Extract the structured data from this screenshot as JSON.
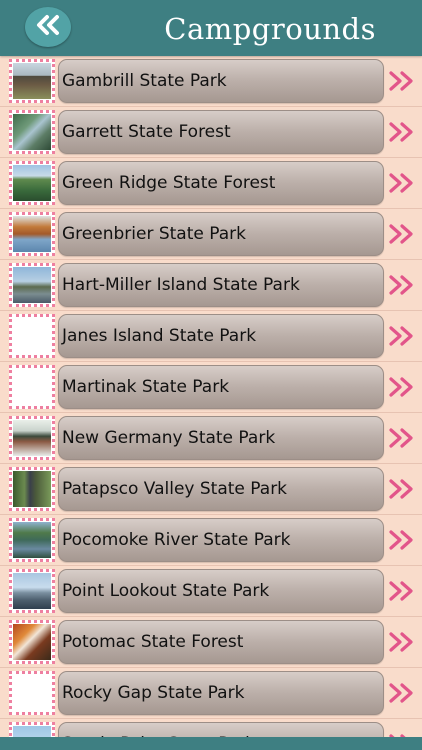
{
  "header": {
    "title": "Campgrounds",
    "back_icon": "double-chevron-left-icon"
  },
  "colors": {
    "header_bg": "#3e7f82",
    "back_button_bg": "#52a3a6",
    "row_bg": "#f9dccb",
    "pill_gradient_top": "#d7cdc8",
    "pill_gradient_bottom": "#a69891",
    "chevron": "#e2558a",
    "thumb_border": "#ee7fa0"
  },
  "parks": [
    {
      "label": "Gambrill State Park",
      "thumb": "photo-cabin"
    },
    {
      "label": "Garrett State Forest",
      "thumb": "photo-forest-river"
    },
    {
      "label": "Green Ridge State Forest",
      "thumb": "photo-valley"
    },
    {
      "label": "Greenbrier State Park",
      "thumb": "photo-lake-autumn"
    },
    {
      "label": "Hart-Miller Island State Park",
      "thumb": "photo-island-shore"
    },
    {
      "label": "Janes Island State Park",
      "thumb": "blank"
    },
    {
      "label": "Martinak State Park",
      "thumb": "blank"
    },
    {
      "label": "New Germany State Park",
      "thumb": "photo-snow-lodge"
    },
    {
      "label": "Patapsco Valley State Park",
      "thumb": "photo-woods-cabin"
    },
    {
      "label": "Pocomoke River State Park",
      "thumb": "photo-river-trees"
    },
    {
      "label": "Point Lookout State Park",
      "thumb": "photo-pier"
    },
    {
      "label": "Potomac State Forest",
      "thumb": "photo-autumn-stream"
    },
    {
      "label": "Rocky Gap State Park",
      "thumb": "blank"
    },
    {
      "label": "Sandy Point State Park",
      "thumb": "photo-beach"
    }
  ]
}
